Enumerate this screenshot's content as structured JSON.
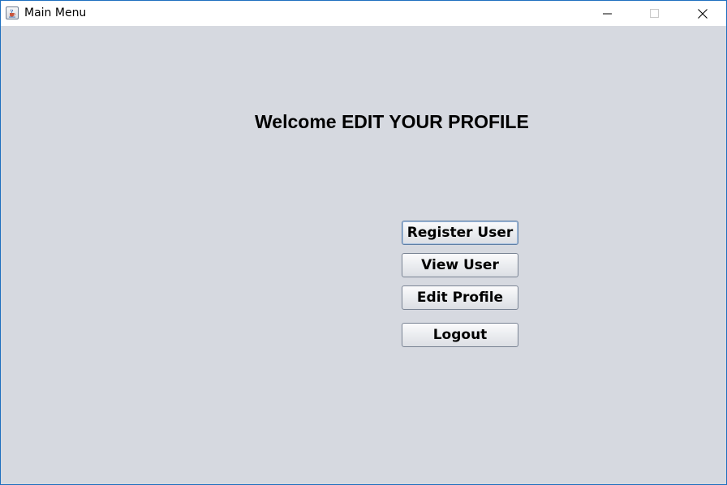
{
  "window": {
    "title": "Main Menu",
    "app_icon": "java-cup-icon",
    "controls": {
      "minimize": "minimize-icon",
      "maximize": "maximize-icon",
      "close": "close-icon"
    }
  },
  "main": {
    "welcome_text": "Welcome EDIT YOUR PROFILE",
    "buttons": {
      "register": "Register User",
      "view": "View User",
      "edit": "Edit Profile",
      "logout": "Logout"
    }
  },
  "colors": {
    "background": "#d6d9e0",
    "window_border": "#1e6fbf",
    "titlebar": "#ffffff",
    "focus_border": "#5f7fa6"
  }
}
